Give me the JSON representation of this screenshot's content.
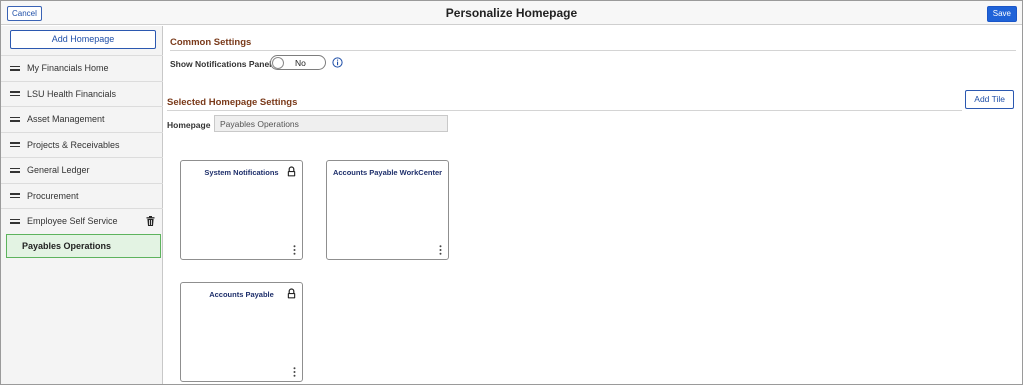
{
  "header": {
    "cancel_label": "Cancel",
    "title": "Personalize Homepage",
    "save_label": "Save"
  },
  "sidebar": {
    "add_homepage_label": "Add Homepage",
    "items": [
      {
        "label": "My Financials Home"
      },
      {
        "label": "LSU Health Financials"
      },
      {
        "label": "Asset Management"
      },
      {
        "label": "Projects & Receivables"
      },
      {
        "label": "General Ledger"
      },
      {
        "label": "Procurement"
      },
      {
        "label": "Employee Self Service"
      },
      {
        "label": "Payables Operations",
        "selected": true
      }
    ]
  },
  "main": {
    "common_settings_title": "Common Settings",
    "notifications": {
      "label": "Show Notifications Panel",
      "value": "No"
    },
    "selected_settings_title": "Selected Homepage Settings",
    "add_tile_label": "Add Tile",
    "homepage": {
      "label": "Homepage",
      "value": "Payables Operations"
    },
    "tiles": [
      {
        "title": "System Notifications",
        "locked": true
      },
      {
        "title": "Accounts Payable WorkCenter",
        "locked": false
      },
      {
        "title": "Accounts Payable",
        "locked": true
      }
    ]
  },
  "colors": {
    "accent": "#1f63d8",
    "section_title": "#7a3a1a",
    "selected_bg": "#e3f3e3",
    "selected_border": "#5db35d"
  }
}
